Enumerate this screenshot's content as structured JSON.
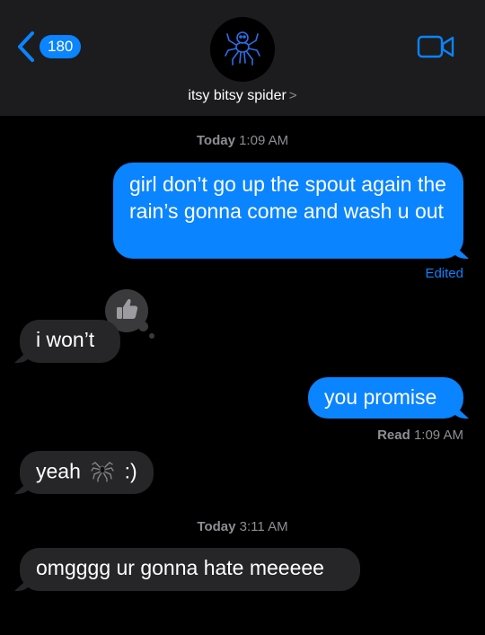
{
  "header": {
    "back_count": "180",
    "contact_name": "itsy bitsy spider",
    "contact_chevron": ">"
  },
  "colors": {
    "accent": "#0a84ff",
    "incoming_bubble": "#262629",
    "header_bg": "#1c1c1e"
  },
  "icons": {
    "back": "chevron-left-icon",
    "video": "video-camera-icon",
    "avatar": "spider-icon",
    "reaction": "thumbs-up-icon",
    "emoji": "spider-emoji"
  },
  "timestamp_1": {
    "day": "Today",
    "time": "1:09 AM"
  },
  "messages": [
    {
      "text": "girl don’t go up the spout again the rain’s gonna come and wash u out",
      "status": "Edited"
    },
    {
      "text": "i won’t"
    },
    {
      "text": "you promise",
      "status_label": "Read",
      "status_time": "1:09 AM"
    },
    {
      "text_before": "yeah",
      "text_after": ":)"
    },
    {
      "text": "omgggg ur gonna hate meeeee"
    }
  ],
  "timestamp_2": {
    "day": "Today",
    "time": "3:11 AM"
  }
}
